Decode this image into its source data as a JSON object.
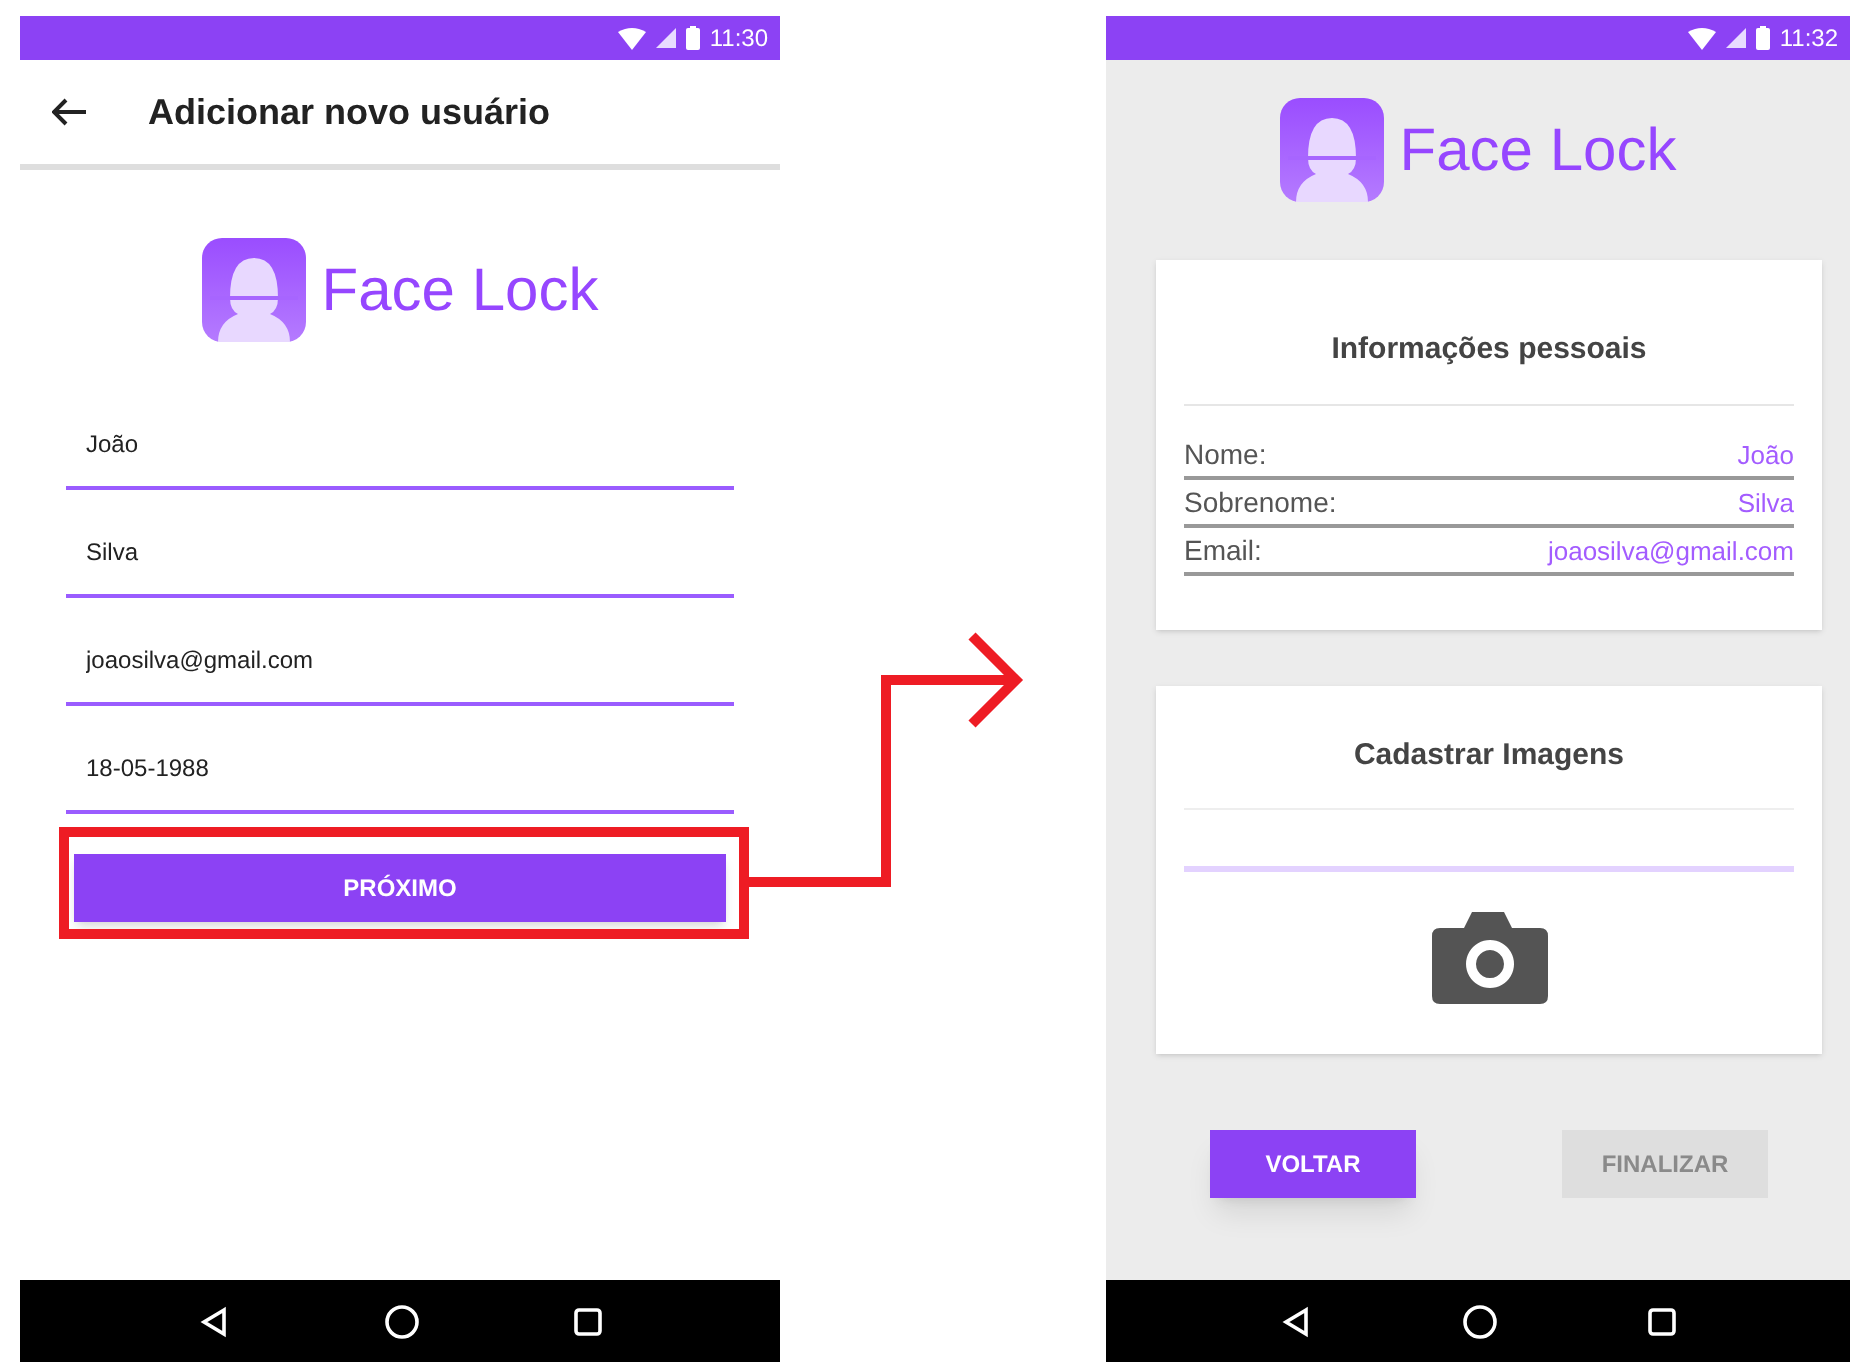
{
  "left_screen": {
    "status_time": "11:30",
    "title": "Adicionar novo usuário",
    "logo_text": "Face Lock",
    "fields": [
      {
        "value": "João"
      },
      {
        "value": "Silva"
      },
      {
        "value": "joaosilva@gmail.com"
      },
      {
        "value": "18-05-1988"
      }
    ],
    "next_button": "PRÓXIMO"
  },
  "right_screen": {
    "status_time": "11:32",
    "logo_text": "Face Lock",
    "info_card": {
      "title": "Informações pessoais",
      "rows": [
        {
          "label": "Nome:",
          "value": "João"
        },
        {
          "label": "Sobrenome:",
          "value": "Silva"
        },
        {
          "label": "Email:",
          "value": "joaosilva@gmail.com"
        }
      ]
    },
    "images_card": {
      "title": "Cadastrar Imagens"
    },
    "buttons": [
      {
        "label": "VOLTAR",
        "disabled": false
      },
      {
        "label": "FINALIZAR",
        "disabled": true
      }
    ]
  }
}
